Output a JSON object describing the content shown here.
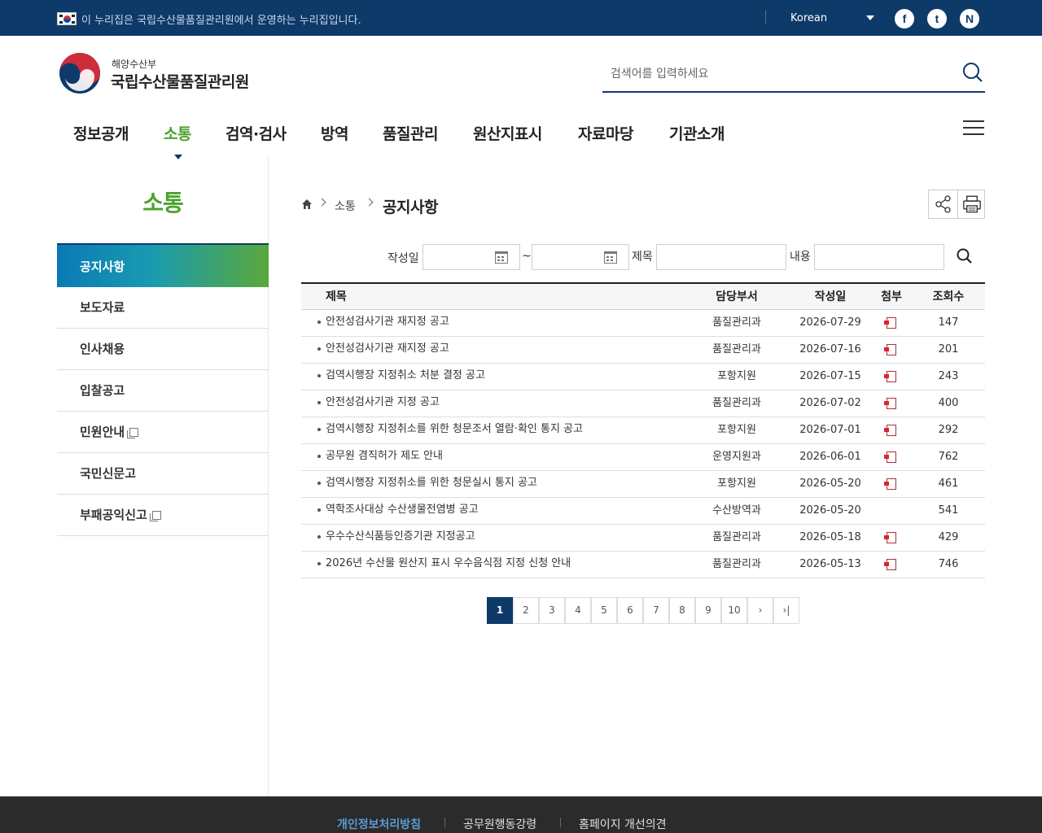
{
  "topbar": {
    "notice": "이 누리집은 국립수산물품질관리원에서 운영하는 누리집입니다.",
    "language": "Korean",
    "sns": [
      "f",
      "t",
      "N"
    ]
  },
  "header": {
    "ministry": "해양수산부",
    "org_name": "국립수산물품질관리원",
    "search_placeholder": "검색어를 입력하세요"
  },
  "gnb": [
    "정보공개",
    "소통",
    "검역·검사",
    "방역",
    "품질관리",
    "원산지표시",
    "자료마당",
    "기관소개"
  ],
  "lnb": {
    "title": "소통",
    "items": [
      "공지사항",
      "보도자료",
      "인사채용",
      "입찰공고",
      "민원안내",
      "국민신문고",
      "부패공익신고"
    ]
  },
  "breadcrumb": {
    "level1": "소통",
    "current": "공지사항"
  },
  "filter": {
    "date_label": "작성일",
    "tilde": "~",
    "title_label": "제목",
    "content_label": "내용"
  },
  "board": {
    "columns": [
      "제목",
      "담당부서",
      "작성일",
      "첨부",
      "조회수"
    ],
    "rows": [
      {
        "title": "안전성검사기관 재지정 공고",
        "dept": "품질관리과",
        "date": "2026-07-29",
        "file": true,
        "views": "147"
      },
      {
        "title": "안전성검사기관 재지정 공고",
        "dept": "품질관리과",
        "date": "2026-07-16",
        "file": true,
        "views": "201"
      },
      {
        "title": "검역시행장 지정취소 처분 결정 공고",
        "dept": "포항지원",
        "date": "2026-07-15",
        "file": true,
        "views": "243"
      },
      {
        "title": "안전성검사기관 지정 공고",
        "dept": "품질관리과",
        "date": "2026-07-02",
        "file": true,
        "views": "400"
      },
      {
        "title": "검역시행장 지정취소를 위한 청문조서 열람·확인 통지 공고",
        "dept": "포항지원",
        "date": "2026-07-01",
        "file": true,
        "views": "292"
      },
      {
        "title": "공무원 겸직허가 제도 안내",
        "dept": "운영지원과",
        "date": "2026-06-01",
        "file": true,
        "views": "762"
      },
      {
        "title": "검역시행장 지정취소를 위한 청문실시 통지 공고",
        "dept": "포항지원",
        "date": "2026-05-20",
        "file": true,
        "views": "461"
      },
      {
        "title": "역학조사대상 수산생물전염병 공고",
        "dept": "수산방역과",
        "date": "2026-05-20",
        "file": false,
        "views": "541"
      },
      {
        "title": "우수수산식품등인증기관 지정공고",
        "dept": "품질관리과",
        "date": "2026-05-18",
        "file": true,
        "views": "429"
      },
      {
        "title": "2026년 수산물 원산지 표시 우수음식점 지정 신청 안내",
        "dept": "품질관리과",
        "date": "2026-05-13",
        "file": true,
        "views": "746"
      }
    ]
  },
  "paging": {
    "pages": [
      "1",
      "2",
      "3",
      "4",
      "5",
      "6",
      "7",
      "8",
      "9",
      "10"
    ],
    "current": "1",
    "next": "›",
    "last": "›|"
  },
  "footer": {
    "links": [
      "개인정보처리방침",
      "공무원행동강령",
      "홈페이지 개선의견"
    ]
  },
  "colors": {
    "navy": "#0e3a6a",
    "green": "#4ca22c"
  }
}
